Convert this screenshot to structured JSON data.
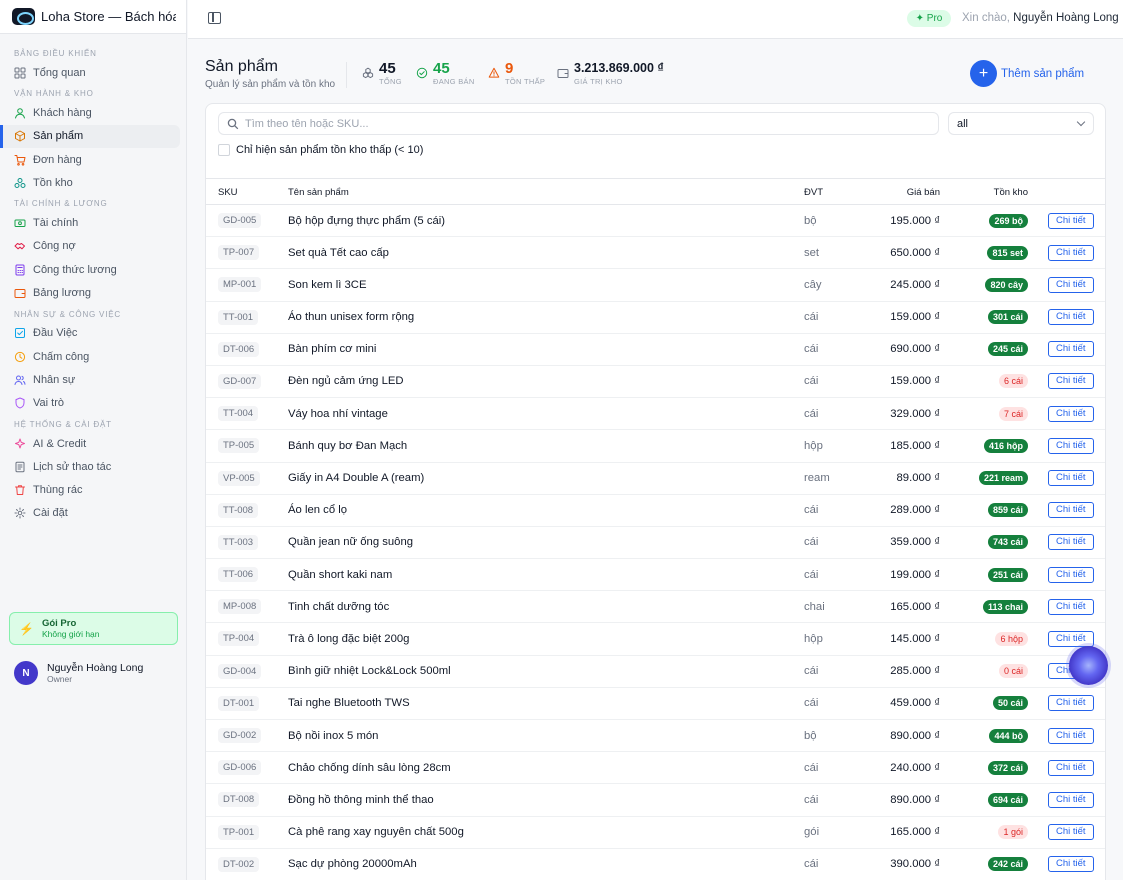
{
  "brand": {
    "name": "Loha Store — Bách hóa ..."
  },
  "topbar": {
    "pro_badge": "✦ Pro",
    "greeting": "Xin chào,",
    "user_name": "Nguyễn Hoàng Long"
  },
  "sidebar": {
    "sections": [
      {
        "title": "BẢNG ĐIỀU KHIỂN",
        "items": [
          {
            "label": "Tổng quan",
            "icon": "grid-icon"
          }
        ]
      },
      {
        "title": "VẬN HÀNH & KHO",
        "items": [
          {
            "label": "Khách hàng",
            "icon": "user-icon"
          },
          {
            "label": "Sản phẩm",
            "icon": "box-icon",
            "active": true
          },
          {
            "label": "Đơn hàng",
            "icon": "cart-icon"
          },
          {
            "label": "Tồn kho",
            "icon": "boxes-icon"
          }
        ]
      },
      {
        "title": "TÀI CHÍNH & LƯƠNG",
        "items": [
          {
            "label": "Tài chính",
            "icon": "cash-icon"
          },
          {
            "label": "Công nợ",
            "icon": "handshake-icon"
          },
          {
            "label": "Công thức lương",
            "icon": "calculator-icon"
          },
          {
            "label": "Bảng lương",
            "icon": "wallet-icon"
          }
        ]
      },
      {
        "title": "NHÂN SỰ & CÔNG VIỆC",
        "items": [
          {
            "label": "Đầu Việc",
            "icon": "checklist-icon"
          },
          {
            "label": "Chấm công",
            "icon": "clock-icon"
          },
          {
            "label": "Nhân sự",
            "icon": "users-icon"
          },
          {
            "label": "Vai trò",
            "icon": "shield-icon"
          }
        ]
      },
      {
        "title": "HỆ THỐNG & CÀI ĐẶT",
        "items": [
          {
            "label": "AI & Credit",
            "icon": "sparkle-icon"
          },
          {
            "label": "Lịch sử thao tác",
            "icon": "history-icon"
          },
          {
            "label": "Thùng rác",
            "icon": "trash-icon"
          },
          {
            "label": "Cài đặt",
            "icon": "gear-icon"
          }
        ]
      }
    ],
    "plan": {
      "title": "Gói Pro",
      "subtitle": "Không giới hạn"
    },
    "user": {
      "initial": "N",
      "name": "Nguyễn Hoàng Long",
      "role": "Owner"
    }
  },
  "header": {
    "title": "Sản phẩm",
    "subtitle": "Quản lý sản phẩm và tồn kho",
    "stats": [
      {
        "value": "45",
        "label": "TỔNG",
        "color": "#111827",
        "icon": "cubes-icon"
      },
      {
        "value": "45",
        "label": "ĐANG BÁN",
        "color": "#16a34a",
        "icon": "check-circle-icon"
      },
      {
        "value": "9",
        "label": "TỒN THẤP",
        "color": "#ea580c",
        "icon": "warning-icon"
      },
      {
        "value": "3.213.869.000 ₫",
        "label": "GIÁ TRỊ KHO",
        "color": "#111827",
        "icon": "wallet-icon"
      }
    ],
    "add_button": "Thêm sản phẩm"
  },
  "filters": {
    "search_placeholder": "Tìm theo tên hoặc SKU...",
    "select_value": "all",
    "low_stock_label": "Chỉ hiện sản phẩm tồn kho thấp (< 10)"
  },
  "table": {
    "columns": {
      "sku": "SKU",
      "name": "Tên sản phẩm",
      "unit": "ĐVT",
      "price": "Giá bán",
      "stock": "Tồn kho"
    },
    "detail_label": "Chi tiết",
    "rows": [
      {
        "sku": "GD-005",
        "name": "Bộ hộp đựng thực phẩm (5 cái)",
        "unit": "bộ",
        "price": "195.000 ₫",
        "stock": "269 bộ",
        "low": false
      },
      {
        "sku": "TP-007",
        "name": "Set quà Tết cao cấp",
        "unit": "set",
        "price": "650.000 ₫",
        "stock": "815 set",
        "low": false
      },
      {
        "sku": "MP-001",
        "name": "Son kem lì 3CE",
        "unit": "cây",
        "price": "245.000 ₫",
        "stock": "820 cây",
        "low": false
      },
      {
        "sku": "TT-001",
        "name": "Áo thun unisex form rộng",
        "unit": "cái",
        "price": "159.000 ₫",
        "stock": "301 cái",
        "low": false
      },
      {
        "sku": "DT-006",
        "name": "Bàn phím cơ mini",
        "unit": "cái",
        "price": "690.000 ₫",
        "stock": "245 cái",
        "low": false
      },
      {
        "sku": "GD-007",
        "name": "Đèn ngủ cảm ứng LED",
        "unit": "cái",
        "price": "159.000 ₫",
        "stock": "6 cái",
        "low": true
      },
      {
        "sku": "TT-004",
        "name": "Váy hoa nhí vintage",
        "unit": "cái",
        "price": "329.000 ₫",
        "stock": "7 cái",
        "low": true
      },
      {
        "sku": "TP-005",
        "name": "Bánh quy bơ Đan Mạch",
        "unit": "hộp",
        "price": "185.000 ₫",
        "stock": "416 hộp",
        "low": false
      },
      {
        "sku": "VP-005",
        "name": "Giấy in A4 Double A (ream)",
        "unit": "ream",
        "price": "89.000 ₫",
        "stock": "221 ream",
        "low": false
      },
      {
        "sku": "TT-008",
        "name": "Áo len cổ lọ",
        "unit": "cái",
        "price": "289.000 ₫",
        "stock": "859 cái",
        "low": false
      },
      {
        "sku": "TT-003",
        "name": "Quần jean nữ ống suông",
        "unit": "cái",
        "price": "359.000 ₫",
        "stock": "743 cái",
        "low": false
      },
      {
        "sku": "TT-006",
        "name": "Quần short kaki nam",
        "unit": "cái",
        "price": "199.000 ₫",
        "stock": "251 cái",
        "low": false
      },
      {
        "sku": "MP-008",
        "name": "Tinh chất dưỡng tóc",
        "unit": "chai",
        "price": "165.000 ₫",
        "stock": "113 chai",
        "low": false
      },
      {
        "sku": "TP-004",
        "name": "Trà ô long đặc biệt 200g",
        "unit": "hộp",
        "price": "145.000 ₫",
        "stock": "6 hộp",
        "low": true
      },
      {
        "sku": "GD-004",
        "name": "Bình giữ nhiệt Lock&Lock 500ml",
        "unit": "cái",
        "price": "285.000 ₫",
        "stock": "0 cái",
        "low": true
      },
      {
        "sku": "DT-001",
        "name": "Tai nghe Bluetooth TWS",
        "unit": "cái",
        "price": "459.000 ₫",
        "stock": "50 cái",
        "low": false
      },
      {
        "sku": "GD-002",
        "name": "Bộ nồi inox 5 món",
        "unit": "bộ",
        "price": "890.000 ₫",
        "stock": "444 bộ",
        "low": false
      },
      {
        "sku": "GD-006",
        "name": "Chảo chống dính sâu lòng 28cm",
        "unit": "cái",
        "price": "240.000 ₫",
        "stock": "372 cái",
        "low": false
      },
      {
        "sku": "DT-008",
        "name": "Đồng hồ thông minh thể thao",
        "unit": "cái",
        "price": "890.000 ₫",
        "stock": "694 cái",
        "low": false
      },
      {
        "sku": "TP-001",
        "name": "Cà phê rang xay nguyên chất 500g",
        "unit": "gói",
        "price": "165.000 ₫",
        "stock": "1 gói",
        "low": true
      },
      {
        "sku": "DT-002",
        "name": "Sạc dự phòng 20000mAh",
        "unit": "cái",
        "price": "390.000 ₫",
        "stock": "242 cái",
        "low": false
      }
    ]
  }
}
